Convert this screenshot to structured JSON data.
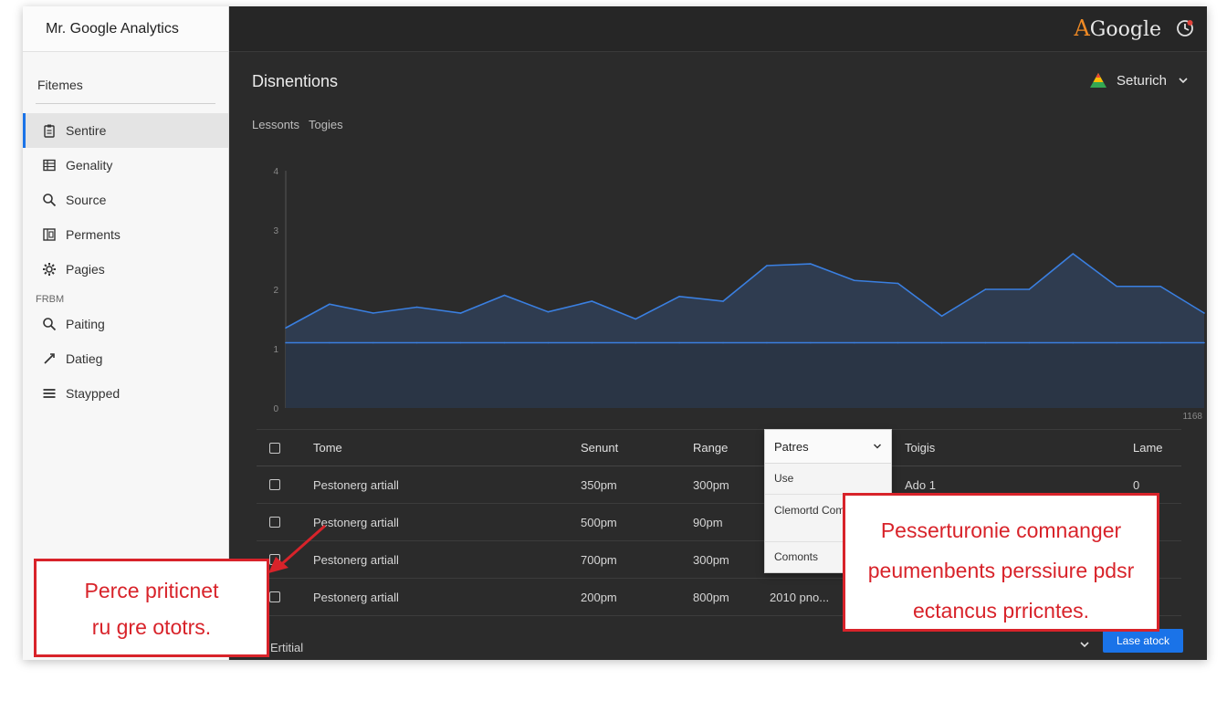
{
  "app": {
    "title": "Mr. Google Analytics",
    "brand": "Google",
    "brand_mark": "A"
  },
  "colors": {
    "accent": "#1a73e8",
    "callout": "#d8232a",
    "chart_line": "#3a7fe0",
    "chart_fill": "#2f3d52"
  },
  "sidebar": {
    "section_label": "Fitemes",
    "items": [
      {
        "label": "Sentire",
        "icon": "clipboard-icon",
        "active": true
      },
      {
        "label": "Genality",
        "icon": "table-icon",
        "active": false
      },
      {
        "label": "Source",
        "icon": "search-icon",
        "active": false
      },
      {
        "label": "Perments",
        "icon": "columns-icon",
        "active": false
      },
      {
        "label": "Pagies",
        "icon": "gear-icon",
        "active": false
      }
    ],
    "group_label": "FRBM",
    "group_items": [
      {
        "label": "Paiting",
        "icon": "search-icon"
      },
      {
        "label": "Datieg",
        "icon": "pencil-icon"
      },
      {
        "label": "Stаypped",
        "icon": "menu-icon"
      }
    ]
  },
  "header": {
    "title": "Disnentions",
    "search_label": "Seturich",
    "sub_tabs": [
      "Lessonts",
      "Togies"
    ]
  },
  "chart_data": {
    "type": "area",
    "y_ticks": [
      "0",
      "1",
      "2",
      "3",
      "4"
    ],
    "corner_label": "1168",
    "ylim": [
      0,
      4
    ],
    "series": [
      {
        "values": [
          1.35,
          1.75,
          1.6,
          1.7,
          1.6,
          1.9,
          1.62,
          1.8,
          1.5,
          1.88,
          1.8,
          2.4,
          2.43,
          2.15,
          2.1,
          1.55,
          2.0,
          2.0,
          2.6,
          2.05,
          2.05,
          1.6
        ]
      },
      {
        "values": [
          1.1,
          1.1,
          1.1,
          1.1,
          1.1,
          1.1,
          1.1,
          1.1,
          1.1,
          1.1,
          1.1,
          1.1,
          1.1,
          1.1,
          1.1,
          1.1,
          1.1,
          1.1,
          1.1,
          1.1,
          1.1,
          1.1
        ]
      }
    ],
    "grid": false
  },
  "table": {
    "headers": {
      "name": "Tome",
      "ser": "Senunt",
      "rng": "Range",
      "tog": "Toigis",
      "lam": "Lame"
    },
    "rows": [
      {
        "name": "Pestonerg artiall",
        "ser": "350pm",
        "rng": "300pm",
        "ext": "",
        "tog": "Ado 1",
        "lam": "0"
      },
      {
        "name": "Pestonerg artiall",
        "ser": "500pm",
        "rng": "90pm",
        "ext": "",
        "tog": "",
        "lam": ""
      },
      {
        "name": "Pestonerg artiall",
        "ser": "700pm",
        "rng": "300pm",
        "ext": "",
        "tog": "",
        "lam": ""
      },
      {
        "name": "Pestonerg artiall",
        "ser": "200pm",
        "rng": "800pm",
        "ext": "2010 pno...",
        "tog": "",
        "lam": ""
      }
    ]
  },
  "dropdown": {
    "selected": "Patres",
    "options": [
      "Use",
      "Clemortd Compeils",
      "Comonts"
    ]
  },
  "footer": {
    "label": "Ertitial",
    "button": "Lase atock"
  },
  "callouts": {
    "left": [
      "Perce priticnet",
      "ru gre ototrs."
    ],
    "right": [
      "Pesserturonie comnanger",
      "peumenbents perssiure pdsr",
      "ectancus prricntes."
    ]
  }
}
